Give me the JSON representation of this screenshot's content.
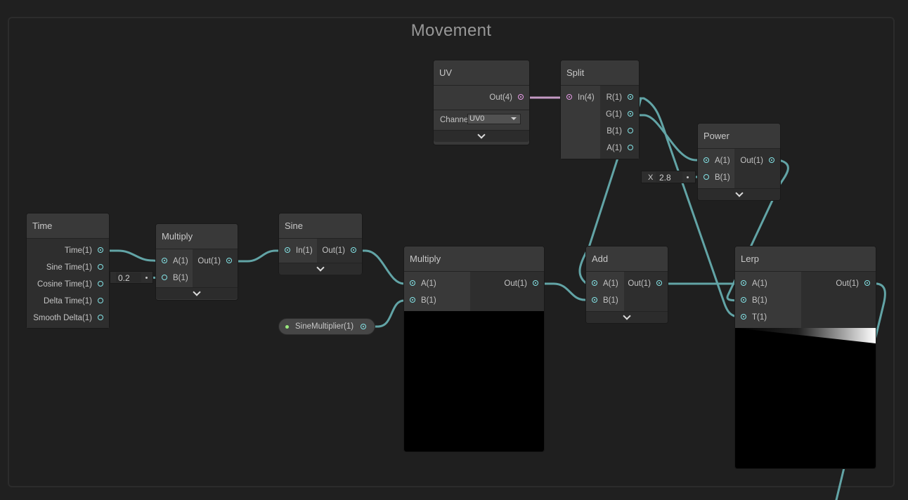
{
  "group": {
    "title": "Movement"
  },
  "colors": {
    "background": "#202020",
    "node": "#393939",
    "wire": "#62a4a6",
    "uv_wire": "#c49ac4",
    "port": "#84e4e7",
    "port_uv": "#ea9cea"
  },
  "nodes": {
    "time": {
      "title": "Time",
      "outputs": [
        "Time(1)",
        "Sine Time(1)",
        "Cosine Time(1)",
        "Delta Time(1)",
        "Smooth Delta(1)"
      ]
    },
    "multiply1": {
      "title": "Multiply",
      "inputs": [
        "A(1)",
        "B(1)"
      ],
      "output": "Out(1)",
      "b_value": "0.2"
    },
    "sine": {
      "title": "Sine",
      "input": "In(1)",
      "output": "Out(1)"
    },
    "multiply2": {
      "title": "Multiply",
      "inputs": [
        "A(1)",
        "B(1)"
      ],
      "output": "Out(1)"
    },
    "uv": {
      "title": "UV",
      "output": "Out(4)",
      "channel_label": "Channe",
      "channel_value": "UV0"
    },
    "split": {
      "title": "Split",
      "input": "In(4)",
      "outputs": [
        "R(1)",
        "G(1)",
        "B(1)",
        "A(1)"
      ]
    },
    "power": {
      "title": "Power",
      "inputs": [
        "A(1)",
        "B(1)"
      ],
      "output": "Out(1)",
      "b_axis": "X",
      "b_value": "2.8"
    },
    "add": {
      "title": "Add",
      "inputs": [
        "A(1)",
        "B(1)"
      ],
      "output": "Out(1)"
    },
    "lerp": {
      "title": "Lerp",
      "inputs": [
        "A(1)",
        "B(1)",
        "T(1)"
      ],
      "output": "Out(1)"
    }
  },
  "property": {
    "label": "SineMultiplier(1)"
  }
}
